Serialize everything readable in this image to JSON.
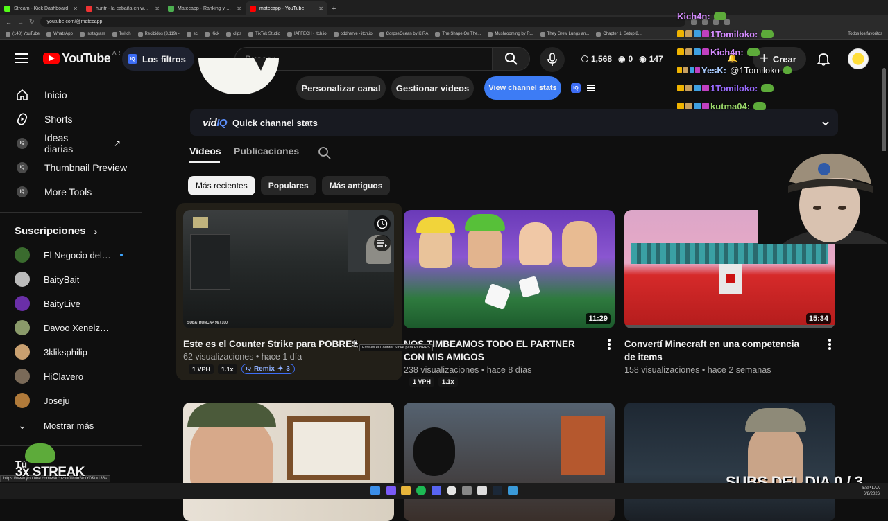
{
  "browser": {
    "tabs": [
      {
        "title": "Stream - Kick Dashboard",
        "color": "#53fc18"
      },
      {
        "title": "huntr - la cabaña en wwww",
        "color": "#e33"
      },
      {
        "title": "Matecapp - Ranking y Racha d",
        "color": "#4caf50"
      },
      {
        "title": "matecapp - YouTube",
        "color": "#ff0000",
        "active": true
      }
    ],
    "new_tab_glyph": "+",
    "url": "youtube.com/@matecapp",
    "bookmarks": [
      "(148) YouTube",
      "WhatsApp",
      "Instagram",
      "Twitch",
      "Recibidos (3.119) -",
      "sc",
      "Kick",
      "clips",
      "TikTok Studio",
      "IAFFECH - itch.io",
      "oddnerve - itch.io",
      "CorpseOcean by KIRA",
      "The Shape On The...",
      "Mushrooming by R...",
      "They Grew Lungs an...",
      "Chapter 1: Setup 8..."
    ],
    "bookmarks_all": "Todos los favoritos"
  },
  "header": {
    "logo_text": "YouTube",
    "country": "AR",
    "filters_label": "Los filtros",
    "search_placeholder": "Buscar",
    "stats": {
      "views": "1,568",
      "eye1": "0",
      "eye2": "147"
    },
    "create_label": "Crear"
  },
  "sidebar": {
    "items": [
      {
        "label": "Inicio",
        "icon": "home-icon"
      },
      {
        "label": "Shorts",
        "icon": "shorts-icon"
      },
      {
        "label": "Ideas diarias",
        "icon": "vidiq-icon"
      },
      {
        "label": "Thumbnail Preview",
        "icon": "vidiq-icon"
      },
      {
        "label": "More Tools",
        "icon": "vidiq-icon"
      }
    ],
    "subs_title": "Suscripciones",
    "channels": [
      {
        "name": "El Negocio del F...",
        "color": "#3a6b2e",
        "new": true
      },
      {
        "name": "BaityBait",
        "color": "#bbb"
      },
      {
        "name": "BaityLive",
        "color": "#6a2fa8"
      },
      {
        "name": "Davoo Xeneize Plus",
        "color": "#8a9a6a"
      },
      {
        "name": "3kliksphilip",
        "color": "#c9a070"
      },
      {
        "name": "HiClavero",
        "color": "#7a6a58"
      },
      {
        "name": "Joseju",
        "color": "#b07a3a"
      }
    ],
    "show_more": "Mostrar más"
  },
  "channel": {
    "customize_label": "Personalizar canal",
    "manage_label": "Gestionar videos",
    "stats_label": "View channel stats",
    "vidiq_logo_a": "vid",
    "vidiq_logo_b": "IQ",
    "vidiq_label": "Quick channel stats",
    "tabs": [
      "Videos",
      "Publicaciones"
    ],
    "chips": [
      "Más recientes",
      "Populares",
      "Más antiguos"
    ]
  },
  "videos": [
    {
      "title": "Este es el Counter Strike para POBRES",
      "views": "62 visualizaciones",
      "age": "hace 1 día",
      "vph": "1 VPH",
      "mult": "1.1x",
      "remix": "Remix",
      "remix_count": "3",
      "thumb_text": "SUBATHONCAP 96 / 100"
    },
    {
      "title": "NOS TIMBEAMOS TODO EL PARTNER CON MIS AMIGOS",
      "views": "238 visualizaciones",
      "age": "hace 8 días",
      "duration": "11:29",
      "vph": "1 VPH",
      "mult": "1.1x"
    },
    {
      "title": "Convertí Minecraft en una competencia de items",
      "views": "158 visualizaciones",
      "age": "hace 2 semanas",
      "duration": "15:34"
    }
  ],
  "overlay": {
    "chat": [
      {
        "user": "Kich4n:",
        "color": "#d58cff"
      },
      {
        "user": "1Tomiloko:",
        "color": "#d58cff"
      },
      {
        "user": "Kich4n:",
        "color": "#d58cff"
      },
      {
        "user": "YesK:",
        "msg": "@1Tomiloko",
        "color": "#aaccff"
      },
      {
        "user": "1Tomiloko:",
        "color": "#9a6bff"
      },
      {
        "user": "kutma04:",
        "color": "#9bd86a"
      }
    ],
    "streak_you": "Tú",
    "streak_label": "3x STREAK",
    "subs_dia": "SUBS DEL DIA 0 / 3",
    "status_url": "https://www.youtube.com/watch?v=fillcomVotY0&t=136s",
    "tooltip": "Este es el Counter Strike para POBRES"
  },
  "taskbar": {
    "lang": "ESP LAA",
    "date": "6/8/2026"
  }
}
